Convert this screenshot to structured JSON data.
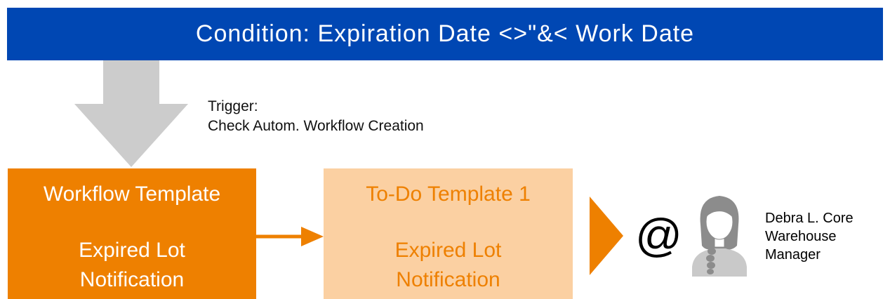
{
  "condition": {
    "text": "Condition: Expiration Date <>\"&< Work Date"
  },
  "trigger": {
    "label": "Trigger:",
    "action": "Check Autom. Workflow Creation"
  },
  "workflow_box": {
    "title": "Workflow Template",
    "line1": "Expired Lot",
    "line2": "Notification"
  },
  "todo_box": {
    "title": "To-Do Template 1",
    "line1": "Expired Lot",
    "line2": "Notification"
  },
  "at_symbol": "@",
  "recipient": {
    "name": "Debra L. Core",
    "role_line1": "Warehouse",
    "role_line2": "Manager",
    "icon": "person-avatar-icon"
  },
  "colors": {
    "banner": "#0047b3",
    "orange": "#ee8000",
    "light_orange": "#fbd0a2",
    "gray_arrow": "#cccccc",
    "avatar_gray": "#8c8c8c"
  }
}
